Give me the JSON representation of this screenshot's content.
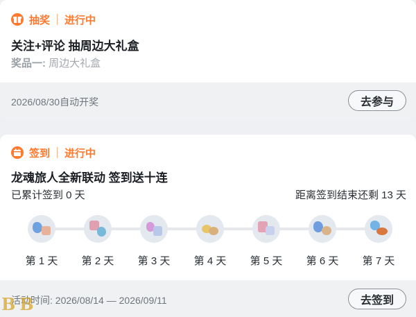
{
  "lottery_card": {
    "tag": "抽奖",
    "status": "进行中",
    "title": "关注+评论 抽周边大礼盒",
    "prize_key": "奖品一:",
    "prize_value": "周边大礼盒",
    "footer_text": "2026/08/30自动开奖",
    "button_label": "去参与",
    "accent_color": "#ff7a2e"
  },
  "signin_card": {
    "tag": "签到",
    "status": "进行中",
    "title": "龙魂旅人全新联动 签到送十连",
    "accumulated": "已累计签到 0 天",
    "remaining": "距离签到结束还剩 13 天",
    "days": [
      {
        "label": "第 1 天",
        "icon": "crystal-and-ticket-icon"
      },
      {
        "label": "第 2 天",
        "icon": "gift-and-crystal-icon"
      },
      {
        "label": "第 3 天",
        "icon": "potion-and-card-icon"
      },
      {
        "label": "第 4 天",
        "icon": "coin-pile-icon"
      },
      {
        "label": "第 5 天",
        "icon": "ticket-pair-icon"
      },
      {
        "label": "第 6 天",
        "icon": "crystal-and-shell-icon"
      },
      {
        "label": "第 7 天",
        "icon": "crystal-and-food-icon"
      }
    ],
    "footer_text": "活动时间: 2026/08/14 — 2026/09/11",
    "button_label": "去签到"
  },
  "watermark": "BB"
}
